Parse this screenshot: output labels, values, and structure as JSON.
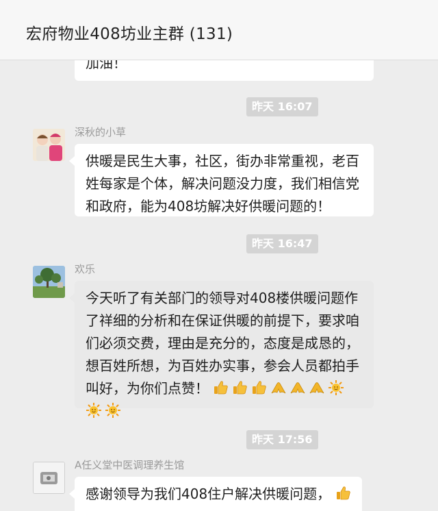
{
  "header": {
    "title": "宏府物业408坊业主群 (131)"
  },
  "messages": [
    {
      "text": "加油！"
    },
    {
      "time": "昨天 16:07",
      "sender": "深秋的小草",
      "lines": [
        "供暖是民生大事，社区，街办非常重视，老百",
        "姓每家是个体，解决问题没力度，我们相信党",
        "和政府，能为408坊解决好供暖问题的！"
      ]
    },
    {
      "time": "昨天 16:47",
      "sender": "欢乐",
      "lines": [
        "今天听了有关部门的领导对408楼供暖问题作",
        "了祥细的分析和在保证供暖的前提下，要求咱",
        "们必须交费，理由是充分的，态度是成恳的，",
        "想百姓所想，为百姓办实事，参会人员都拍手",
        "叫好，为你们点赞！"
      ],
      "emojis_line5": [
        "thumbs-up-icon",
        "thumbs-up-icon",
        "thumbs-up-icon",
        "strong-icon",
        "strong-icon",
        "strong-icon",
        "sun-icon"
      ],
      "emojis_line6": [
        "sun-icon",
        "sun-icon"
      ]
    },
    {
      "time": "昨天 17:56",
      "sender": "A任义堂中医调理养生馆",
      "text": "感谢领导为我们408住户解决供暖问题，",
      "emojis": [
        "thumbs-up-icon"
      ]
    }
  ],
  "colors": {
    "bubble": "#ffffff",
    "bubble_selected": "#e9e9e9",
    "timestamp_bg": "#d4d4d4",
    "background": "#ededed"
  }
}
